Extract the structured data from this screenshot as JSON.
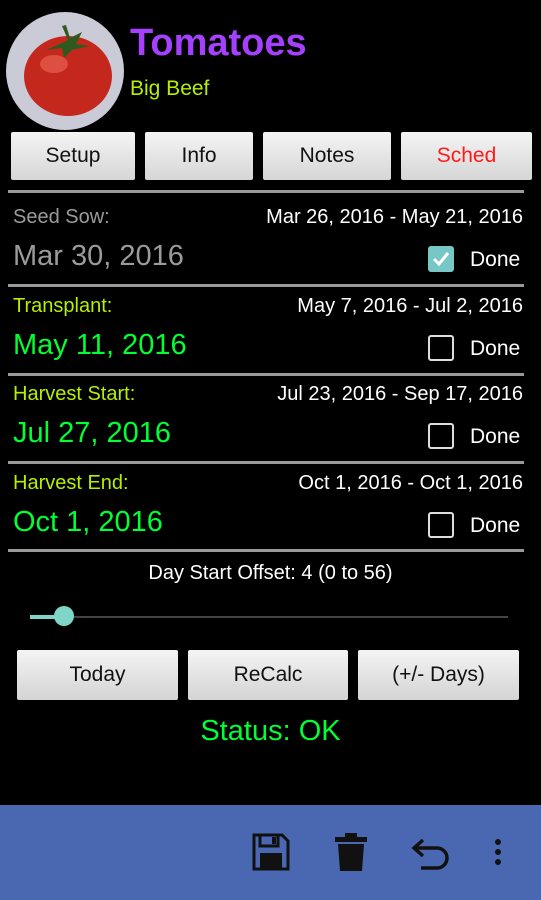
{
  "header": {
    "title": "Tomatoes",
    "subtitle": "Big Beef"
  },
  "tabs": [
    {
      "label": "Setup",
      "active": false
    },
    {
      "label": "Info",
      "active": false
    },
    {
      "label": "Notes",
      "active": false
    },
    {
      "label": "Sched",
      "active": true
    }
  ],
  "schedule": [
    {
      "label": "Seed Sow:",
      "range": "Mar 26, 2016 - May 21, 2016",
      "date": "Mar 30, 2016",
      "done_label": "Done",
      "done": true,
      "color": "#9b9b9b"
    },
    {
      "label": "Transplant:",
      "range": "May 7, 2016 - Jul 2, 2016",
      "date": "May 11, 2016",
      "done_label": "Done",
      "done": false,
      "color": "#00ff33"
    },
    {
      "label": "Harvest Start:",
      "range": "Jul 23, 2016 - Sep 17, 2016",
      "date": "Jul 27, 2016",
      "done_label": "Done",
      "done": false,
      "color": "#00ff33"
    },
    {
      "label": "Harvest End:",
      "range": "Oct 1, 2016 - Oct 1, 2016",
      "date": "Oct 1, 2016",
      "done_label": "Done",
      "done": false,
      "color": "#00ff33"
    }
  ],
  "label_colors": {
    "seed": "#9b9b9b",
    "active": "#b6f000"
  },
  "offset": {
    "text": "Day Start Offset: 4 (0 to 56)",
    "value": 4,
    "min": 0,
    "max": 56
  },
  "buttons": {
    "today": "Today",
    "recalc": "ReCalc",
    "days": "(+/- Days)"
  },
  "status": {
    "text": "Status: OK",
    "color": "#00ff33"
  },
  "toolbar": {
    "icons": [
      "save-icon",
      "delete-icon",
      "undo-icon",
      "overflow-menu-icon"
    ],
    "background": "#4a68b1"
  }
}
